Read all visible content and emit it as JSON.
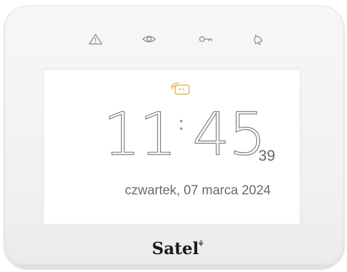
{
  "status_bar": {
    "icons": [
      "alarm-warning-icon",
      "armed-eye-icon",
      "service-key-icon",
      "alarm-bell-icon"
    ],
    "icon_color": "#8a8a8a"
  },
  "screen": {
    "card_icon": "proximity-card-icon",
    "card_icon_color": "#e8b454",
    "clock": {
      "hours": "11",
      "separator": ":",
      "minutes": "45",
      "seconds": "39"
    },
    "date": "czwartek, 07 marca 2024"
  },
  "brand": {
    "logo": "Satel",
    "mark": "⚘"
  }
}
